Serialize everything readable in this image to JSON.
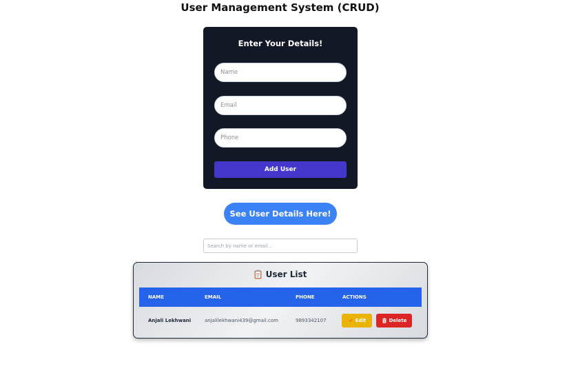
{
  "page": {
    "title": "User Management System (CRUD)"
  },
  "form": {
    "title": "Enter Your Details!",
    "name_placeholder": "Name",
    "email_placeholder": "Email",
    "phone_placeholder": "Phone",
    "add_label": "Add User"
  },
  "see_details_label": "See User Details Here!",
  "search": {
    "placeholder": "Search by name or email..."
  },
  "user_list": {
    "title": "User List",
    "icon": "clipboard-icon",
    "columns": [
      "NAME",
      "EMAIL",
      "PHONE",
      "ACTIONS"
    ],
    "rows": [
      {
        "name": "Anjali Lekhwani",
        "email": "anjalilekhwani439@gmail.com",
        "phone": "9893342107",
        "edit_label": "Edit",
        "delete_label": "Delete"
      }
    ]
  },
  "colors": {
    "form_bg": "#121826",
    "add_button": "#4338ca",
    "see_button": "#3b82f6",
    "table_header": "#2563eb",
    "edit_button": "#eab308",
    "delete_button": "#dc2626"
  }
}
